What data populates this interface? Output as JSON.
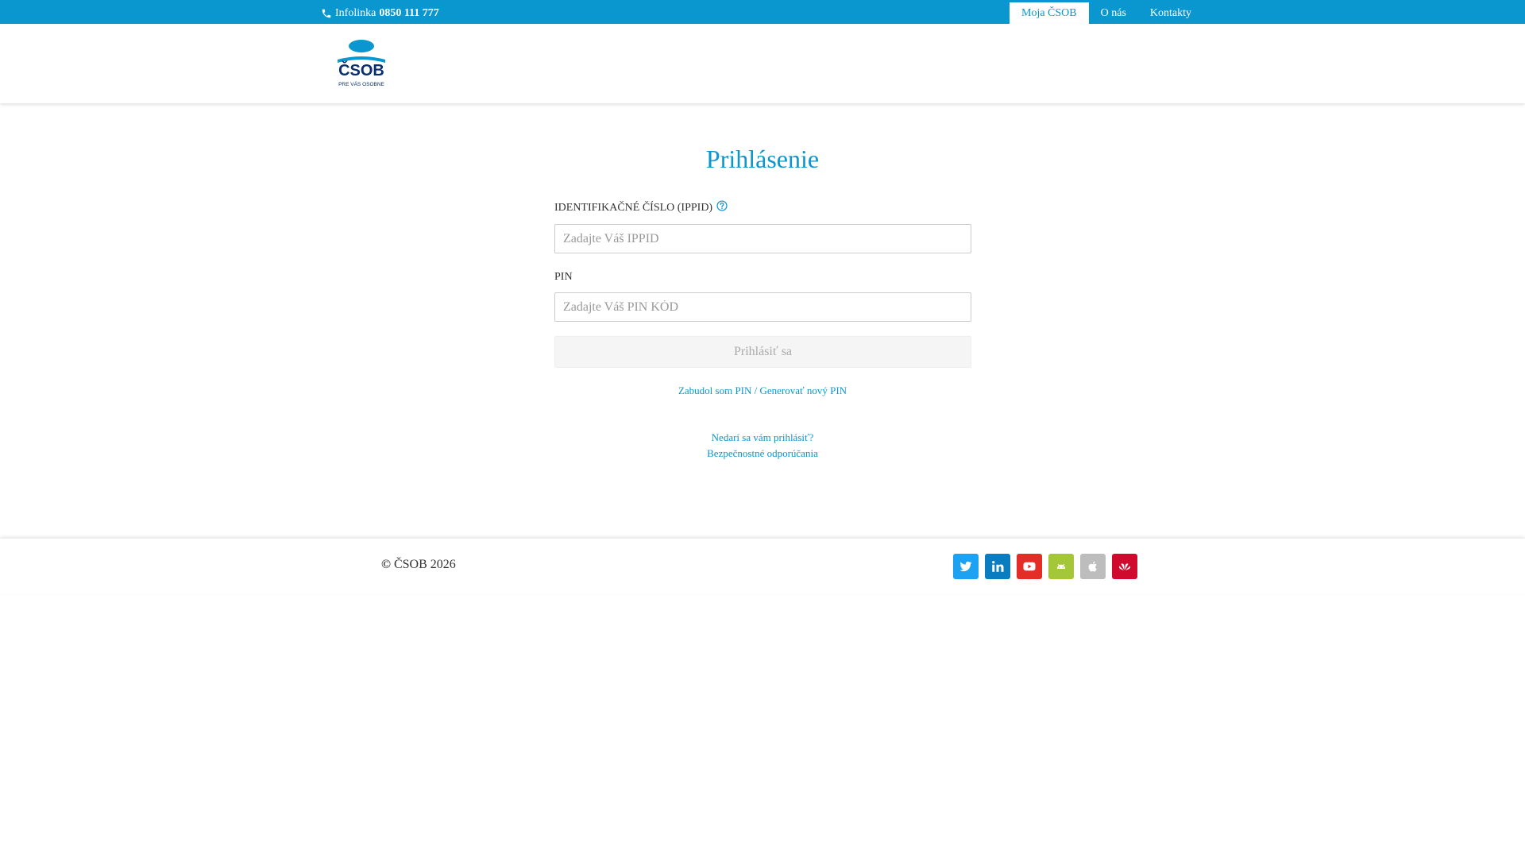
{
  "topbar": {
    "infoline_label": "Infolinka",
    "infoline_number": "0850 111 777",
    "nav": [
      {
        "label": "Moja ČSOB",
        "active": true
      },
      {
        "label": "O nás",
        "active": false
      },
      {
        "label": "Kontakty",
        "active": false
      }
    ]
  },
  "header": {
    "logo_text": "ČSOB",
    "logo_tagline": "PRE VÁS OSOBNE"
  },
  "login": {
    "title": "Prihlásenie",
    "ippid_label": "IDENTIFIKAČNÉ ČÍSLO (IPPID)",
    "ippid_placeholder": "Zadajte Váš IPPID",
    "pin_label": "PIN",
    "pin_placeholder": "Zadajte Váš PIN KÓD",
    "submit_label": "Prihlásiť sa",
    "forgot_link": "Zabudol som PIN / Generovať nový PIN",
    "help_link": "Nedarí sa vám prihlásiť?",
    "security_link": "Bezpečnostné odporúčania"
  },
  "footer": {
    "copyright_symbol": "©",
    "copyright_text": "ČSOB 2026",
    "socials": [
      {
        "icon": "twitter-icon",
        "color": "#1da1f2"
      },
      {
        "icon": "linkedin-icon",
        "color": "#0a7cc0"
      },
      {
        "icon": "youtube-icon",
        "color": "#e52d27"
      },
      {
        "icon": "android-icon",
        "color": "#a4c639"
      },
      {
        "icon": "apple-icon",
        "color": "#bdbdbd"
      },
      {
        "icon": "huawei-icon",
        "color": "#cf0a2c"
      }
    ]
  },
  "colors": {
    "brand": "#0a96cf",
    "logo_navy": "#0b2f6b"
  }
}
